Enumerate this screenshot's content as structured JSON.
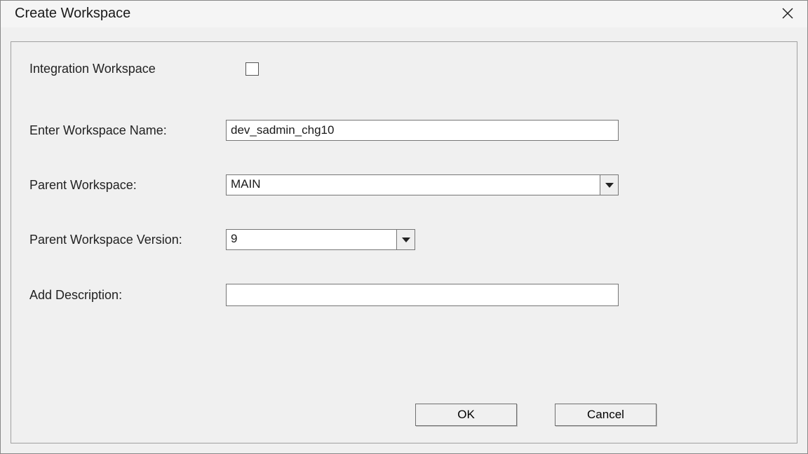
{
  "titlebar": {
    "title": "Create Workspace"
  },
  "form": {
    "integration_label": "Integration Workspace",
    "integration_checked": false,
    "name_label": "Enter Workspace Name:",
    "name_value": "dev_sadmin_chg10",
    "parent_label": "Parent Workspace:",
    "parent_value": "MAIN",
    "version_label": "Parent Workspace Version:",
    "version_value": "9",
    "desc_label": "Add Description:",
    "desc_value": ""
  },
  "buttons": {
    "ok": "OK",
    "cancel": "Cancel"
  }
}
